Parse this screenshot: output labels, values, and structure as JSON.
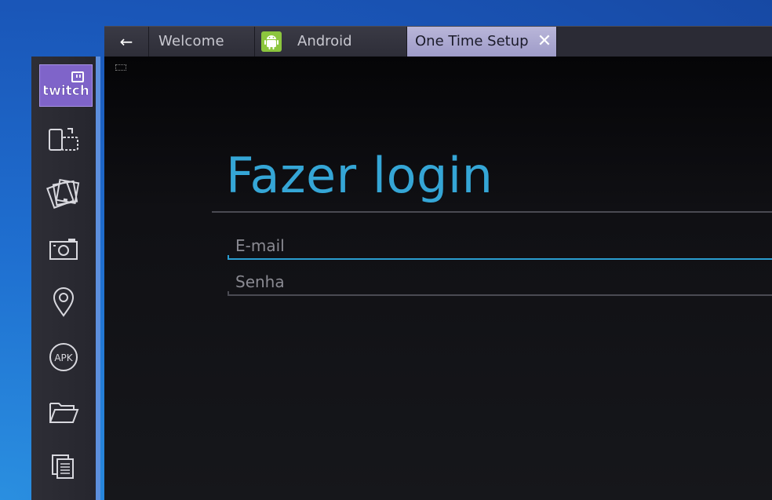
{
  "tabs": {
    "back_icon": "←",
    "welcome": "Welcome",
    "android": "Android",
    "setup": "One Time Setup",
    "close_icon": "✕"
  },
  "sidebar": {
    "items": [
      {
        "name": "twitch",
        "label": "twitch"
      },
      {
        "name": "rotate-screen-icon"
      },
      {
        "name": "cards-icon"
      },
      {
        "name": "camera-icon"
      },
      {
        "name": "location-pin-icon"
      },
      {
        "name": "apk",
        "label": "APK"
      },
      {
        "name": "folder-icon"
      },
      {
        "name": "copy-icon"
      }
    ],
    "accent": "#5d8fdd",
    "twitch_color": "#7f64c9"
  },
  "login": {
    "title": "Fazer login",
    "email_placeholder": "E-mail",
    "password_placeholder": "Senha",
    "accent": "#35a6d6"
  }
}
